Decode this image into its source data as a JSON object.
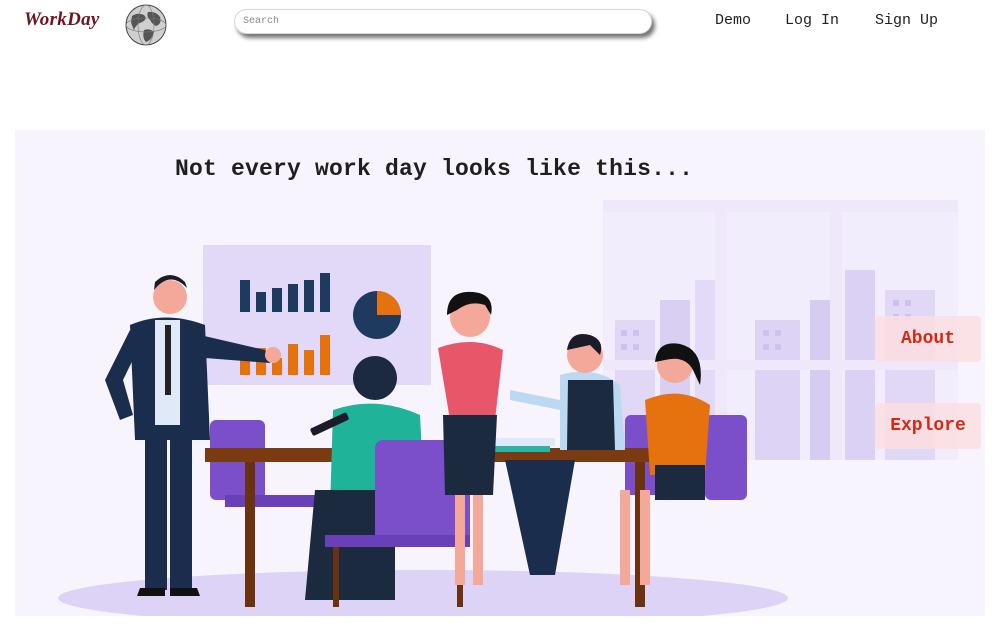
{
  "header": {
    "logo_text": "WorkDay",
    "search": {
      "placeholder": "Search",
      "value": ""
    },
    "nav": {
      "demo": "Demo",
      "login": "Log In",
      "signup": "Sign Up"
    }
  },
  "hero": {
    "title": "Not every work day looks like this...",
    "buttons": {
      "about": "About",
      "explore": "Explore"
    }
  },
  "colors": {
    "logo": "#6e1322",
    "accent_text": "#d32a14",
    "button_bg": "#fcdee2",
    "hero_bg": "#f8f4fe",
    "chart_bars": "#1f3a5f",
    "chart_orange": "#e6720f",
    "chairs": "#7a4fc9",
    "table": "#7a3a12"
  }
}
